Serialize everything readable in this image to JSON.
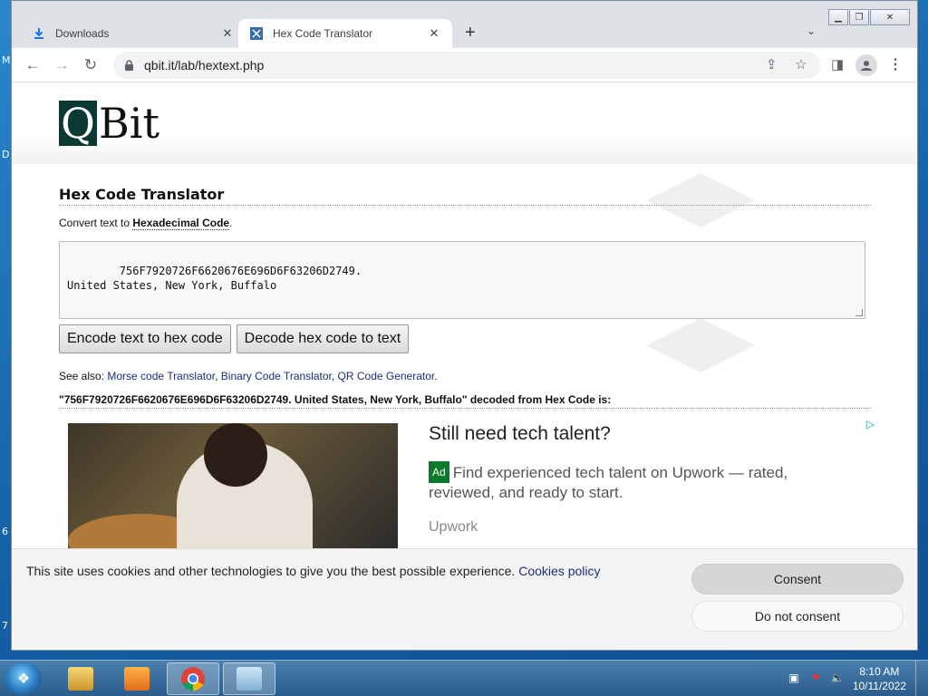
{
  "browser": {
    "tabs": [
      {
        "title": "Downloads",
        "icon": "download-icon"
      },
      {
        "title": "Hex Code Translator",
        "icon": "qbit-favicon"
      }
    ],
    "url": "qbit.it/lab/hextext.php"
  },
  "page": {
    "logo_initial": "Q",
    "logo_rest": "Bit",
    "heading": "Hex Code Translator",
    "subtitle_prefix": "Convert text to ",
    "subtitle_link": "Hexadecimal Code",
    "subtitle_suffix": ".",
    "textarea_value": "756F7920726F6620676E696D6F63206D2749.\nUnited States, New York, Buffalo",
    "encode_button": "Encode text to hex code",
    "decode_button": "Decode hex code to text",
    "see_also_label": "See also: ",
    "see_also_links": [
      "Morse code Translator",
      "Binary Code Translator",
      "QR Code Generator"
    ],
    "decoded_heading": "\"756F7920726F6620676E696D6F63206D2749. United States, New York, Buffalo\" decoded from Hex Code is:"
  },
  "ad": {
    "title": "Still need tech talent?",
    "badge": "Ad",
    "body": "Find experienced tech talent on Upwork — rated, reviewed, and ready to start.",
    "brand": "Upwork"
  },
  "cookie": {
    "text": "This site uses cookies and other technologies to give you the best possible experience.",
    "link": "Cookies policy",
    "consent": "Consent",
    "no_consent": "Do not consent"
  },
  "taskbar": {
    "time": "8:10 AM",
    "date": "10/11/2022"
  },
  "desktop_labels": [
    "M",
    "D",
    "6",
    "7"
  ],
  "colors": {
    "logo_bg": "#0b3a35",
    "link": "#1a2e7a",
    "ad_badge": "#0b7a2a"
  }
}
